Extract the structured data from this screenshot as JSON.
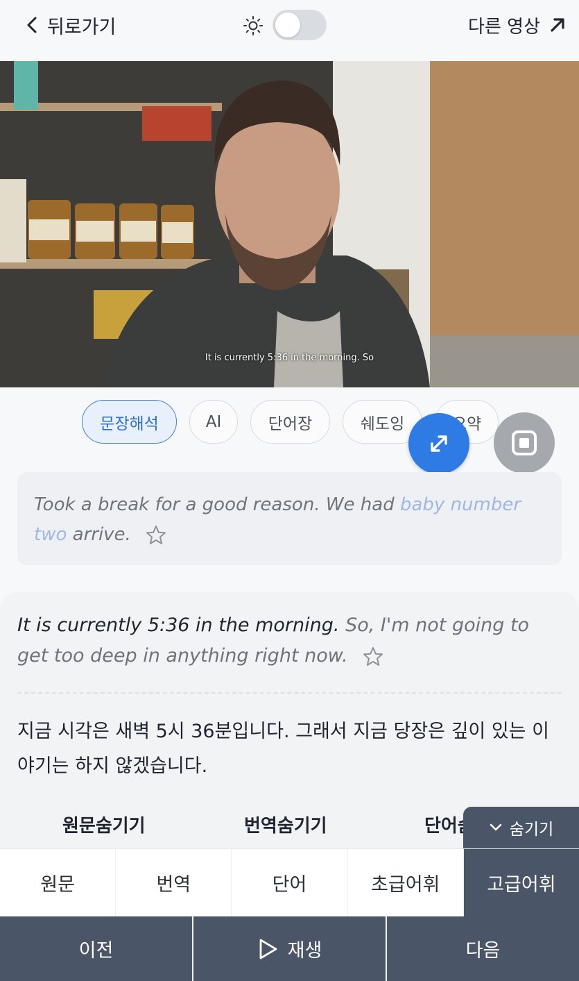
{
  "header": {
    "back_label": "뒤로가기",
    "other_video_label": "다른 영상",
    "theme_toggle_on": false
  },
  "video": {
    "subtitle": "It is currently 5:36 in the morning. So"
  },
  "chips": [
    "문장해석",
    "AI",
    "단어장",
    "쉐도잉",
    "요약"
  ],
  "prev_sentence": {
    "text_before": "Took a break for a good reason. We had ",
    "highlight": "baby number two",
    "text_after": " arrive."
  },
  "current": {
    "english_said": "It is currently 5:36 in the morning.",
    "english_rest": " So, I'm not going to get too deep in anything right now.",
    "korean": "지금 시각은 새벽 5시 36분입니다. 그래서 지금 당장은 깊이 있는 이야기는 하지 않겠습니다."
  },
  "hide_options": {
    "original": "원문숨기기",
    "translation": "번역숨기기",
    "word": "단어숨기기"
  },
  "hide_tab_label": "숨기기",
  "segments": [
    "원문",
    "번역",
    "단어",
    "초급어휘",
    "고급어휘"
  ],
  "active_segment": "고급어휘",
  "nav": {
    "prev": "이전",
    "play": "재생",
    "next": "다음"
  },
  "colors": {
    "accent": "#2f7be6",
    "dark_bar": "#4a5568",
    "highlight": "#9db8e4"
  }
}
